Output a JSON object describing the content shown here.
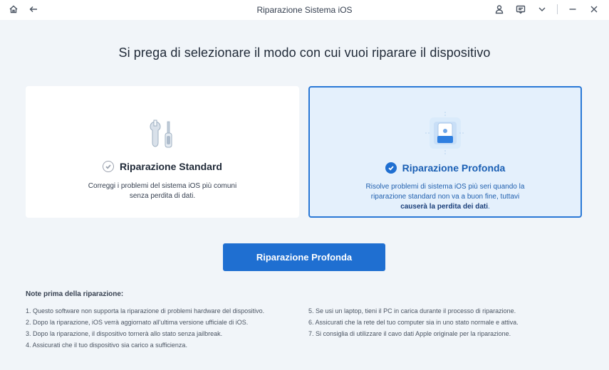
{
  "window": {
    "title": "Riparazione Sistema iOS"
  },
  "heading": "Si prega di selezionare il modo con cui vuoi riparare il dispositivo",
  "cards": {
    "standard": {
      "title": "Riparazione Standard",
      "description_line1": "Correggi i problemi del sistema iOS più comuni",
      "description_line2": "senza perdita di dati."
    },
    "deep": {
      "title": "Riparazione Profonda",
      "description_line1": "Risolve problemi di sistema iOS più seri quando la",
      "description_line2": "riparazione standard non va a buon fine, tuttavi",
      "description_bold": "causerà la perdita dei dati",
      "description_end": "."
    }
  },
  "main_button": "Riparazione Profonda",
  "notes": {
    "title": "Note prima della riparazione:",
    "left": [
      "1. Questo software non supporta la riparazione di problemi hardware del dispositivo.",
      "2. Dopo la riparazione, iOS verrà aggiornato all'ultima versione ufficiale di iOS.",
      "3. Dopo la riparazione, il dispositivo tornerà allo stato senza jailbreak.",
      "4. Assicurati che il tuo dispositivo sia carico a sufficienza."
    ],
    "right": [
      "5. Se usi un laptop, tieni il PC in carica durante il processo di riparazione.",
      "6. Assicurati che la rete del tuo computer sia in uno stato normale e attiva.",
      "7. Si consiglia di utilizzare il cavo dati Apple originale per la riparazione."
    ]
  },
  "colors": {
    "accent": "#1f6fd1",
    "selected_card_bg": "#e4f0fc",
    "background": "#f1f5f9"
  },
  "icons": [
    "home-icon",
    "back-arrow-icon",
    "user-icon",
    "feedback-icon",
    "chevron-down-icon",
    "minimize-icon",
    "close-icon",
    "tools-icon",
    "device-repair-icon",
    "check-icon"
  ]
}
